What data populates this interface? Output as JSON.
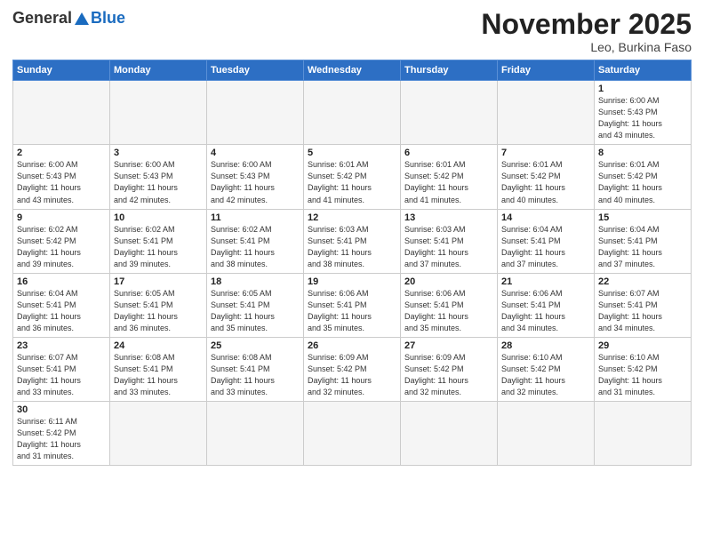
{
  "header": {
    "logo_general": "General",
    "logo_blue": "Blue",
    "month_title": "November 2025",
    "location": "Leo, Burkina Faso"
  },
  "weekdays": [
    "Sunday",
    "Monday",
    "Tuesday",
    "Wednesday",
    "Thursday",
    "Friday",
    "Saturday"
  ],
  "days": [
    {
      "num": "",
      "info": "",
      "empty": true
    },
    {
      "num": "",
      "info": "",
      "empty": true
    },
    {
      "num": "",
      "info": "",
      "empty": true
    },
    {
      "num": "",
      "info": "",
      "empty": true
    },
    {
      "num": "",
      "info": "",
      "empty": true
    },
    {
      "num": "",
      "info": "",
      "empty": true
    },
    {
      "num": "1",
      "info": "Sunrise: 6:00 AM\nSunset: 5:43 PM\nDaylight: 11 hours\nand 43 minutes."
    },
    {
      "num": "2",
      "info": "Sunrise: 6:00 AM\nSunset: 5:43 PM\nDaylight: 11 hours\nand 43 minutes."
    },
    {
      "num": "3",
      "info": "Sunrise: 6:00 AM\nSunset: 5:43 PM\nDaylight: 11 hours\nand 42 minutes."
    },
    {
      "num": "4",
      "info": "Sunrise: 6:00 AM\nSunset: 5:43 PM\nDaylight: 11 hours\nand 42 minutes."
    },
    {
      "num": "5",
      "info": "Sunrise: 6:01 AM\nSunset: 5:42 PM\nDaylight: 11 hours\nand 41 minutes."
    },
    {
      "num": "6",
      "info": "Sunrise: 6:01 AM\nSunset: 5:42 PM\nDaylight: 11 hours\nand 41 minutes."
    },
    {
      "num": "7",
      "info": "Sunrise: 6:01 AM\nSunset: 5:42 PM\nDaylight: 11 hours\nand 40 minutes."
    },
    {
      "num": "8",
      "info": "Sunrise: 6:01 AM\nSunset: 5:42 PM\nDaylight: 11 hours\nand 40 minutes."
    },
    {
      "num": "9",
      "info": "Sunrise: 6:02 AM\nSunset: 5:42 PM\nDaylight: 11 hours\nand 39 minutes."
    },
    {
      "num": "10",
      "info": "Sunrise: 6:02 AM\nSunset: 5:41 PM\nDaylight: 11 hours\nand 39 minutes."
    },
    {
      "num": "11",
      "info": "Sunrise: 6:02 AM\nSunset: 5:41 PM\nDaylight: 11 hours\nand 38 minutes."
    },
    {
      "num": "12",
      "info": "Sunrise: 6:03 AM\nSunset: 5:41 PM\nDaylight: 11 hours\nand 38 minutes."
    },
    {
      "num": "13",
      "info": "Sunrise: 6:03 AM\nSunset: 5:41 PM\nDaylight: 11 hours\nand 37 minutes."
    },
    {
      "num": "14",
      "info": "Sunrise: 6:04 AM\nSunset: 5:41 PM\nDaylight: 11 hours\nand 37 minutes."
    },
    {
      "num": "15",
      "info": "Sunrise: 6:04 AM\nSunset: 5:41 PM\nDaylight: 11 hours\nand 37 minutes."
    },
    {
      "num": "16",
      "info": "Sunrise: 6:04 AM\nSunset: 5:41 PM\nDaylight: 11 hours\nand 36 minutes."
    },
    {
      "num": "17",
      "info": "Sunrise: 6:05 AM\nSunset: 5:41 PM\nDaylight: 11 hours\nand 36 minutes."
    },
    {
      "num": "18",
      "info": "Sunrise: 6:05 AM\nSunset: 5:41 PM\nDaylight: 11 hours\nand 35 minutes."
    },
    {
      "num": "19",
      "info": "Sunrise: 6:06 AM\nSunset: 5:41 PM\nDaylight: 11 hours\nand 35 minutes."
    },
    {
      "num": "20",
      "info": "Sunrise: 6:06 AM\nSunset: 5:41 PM\nDaylight: 11 hours\nand 35 minutes."
    },
    {
      "num": "21",
      "info": "Sunrise: 6:06 AM\nSunset: 5:41 PM\nDaylight: 11 hours\nand 34 minutes."
    },
    {
      "num": "22",
      "info": "Sunrise: 6:07 AM\nSunset: 5:41 PM\nDaylight: 11 hours\nand 34 minutes."
    },
    {
      "num": "23",
      "info": "Sunrise: 6:07 AM\nSunset: 5:41 PM\nDaylight: 11 hours\nand 33 minutes."
    },
    {
      "num": "24",
      "info": "Sunrise: 6:08 AM\nSunset: 5:41 PM\nDaylight: 11 hours\nand 33 minutes."
    },
    {
      "num": "25",
      "info": "Sunrise: 6:08 AM\nSunset: 5:41 PM\nDaylight: 11 hours\nand 33 minutes."
    },
    {
      "num": "26",
      "info": "Sunrise: 6:09 AM\nSunset: 5:42 PM\nDaylight: 11 hours\nand 32 minutes."
    },
    {
      "num": "27",
      "info": "Sunrise: 6:09 AM\nSunset: 5:42 PM\nDaylight: 11 hours\nand 32 minutes."
    },
    {
      "num": "28",
      "info": "Sunrise: 6:10 AM\nSunset: 5:42 PM\nDaylight: 11 hours\nand 32 minutes."
    },
    {
      "num": "29",
      "info": "Sunrise: 6:10 AM\nSunset: 5:42 PM\nDaylight: 11 hours\nand 31 minutes."
    },
    {
      "num": "30",
      "info": "Sunrise: 6:11 AM\nSunset: 5:42 PM\nDaylight: 11 hours\nand 31 minutes."
    },
    {
      "num": "",
      "info": "",
      "empty": true
    },
    {
      "num": "",
      "info": "",
      "empty": true
    },
    {
      "num": "",
      "info": "",
      "empty": true
    },
    {
      "num": "",
      "info": "",
      "empty": true
    },
    {
      "num": "",
      "info": "",
      "empty": true
    },
    {
      "num": "",
      "info": "",
      "empty": true
    }
  ]
}
